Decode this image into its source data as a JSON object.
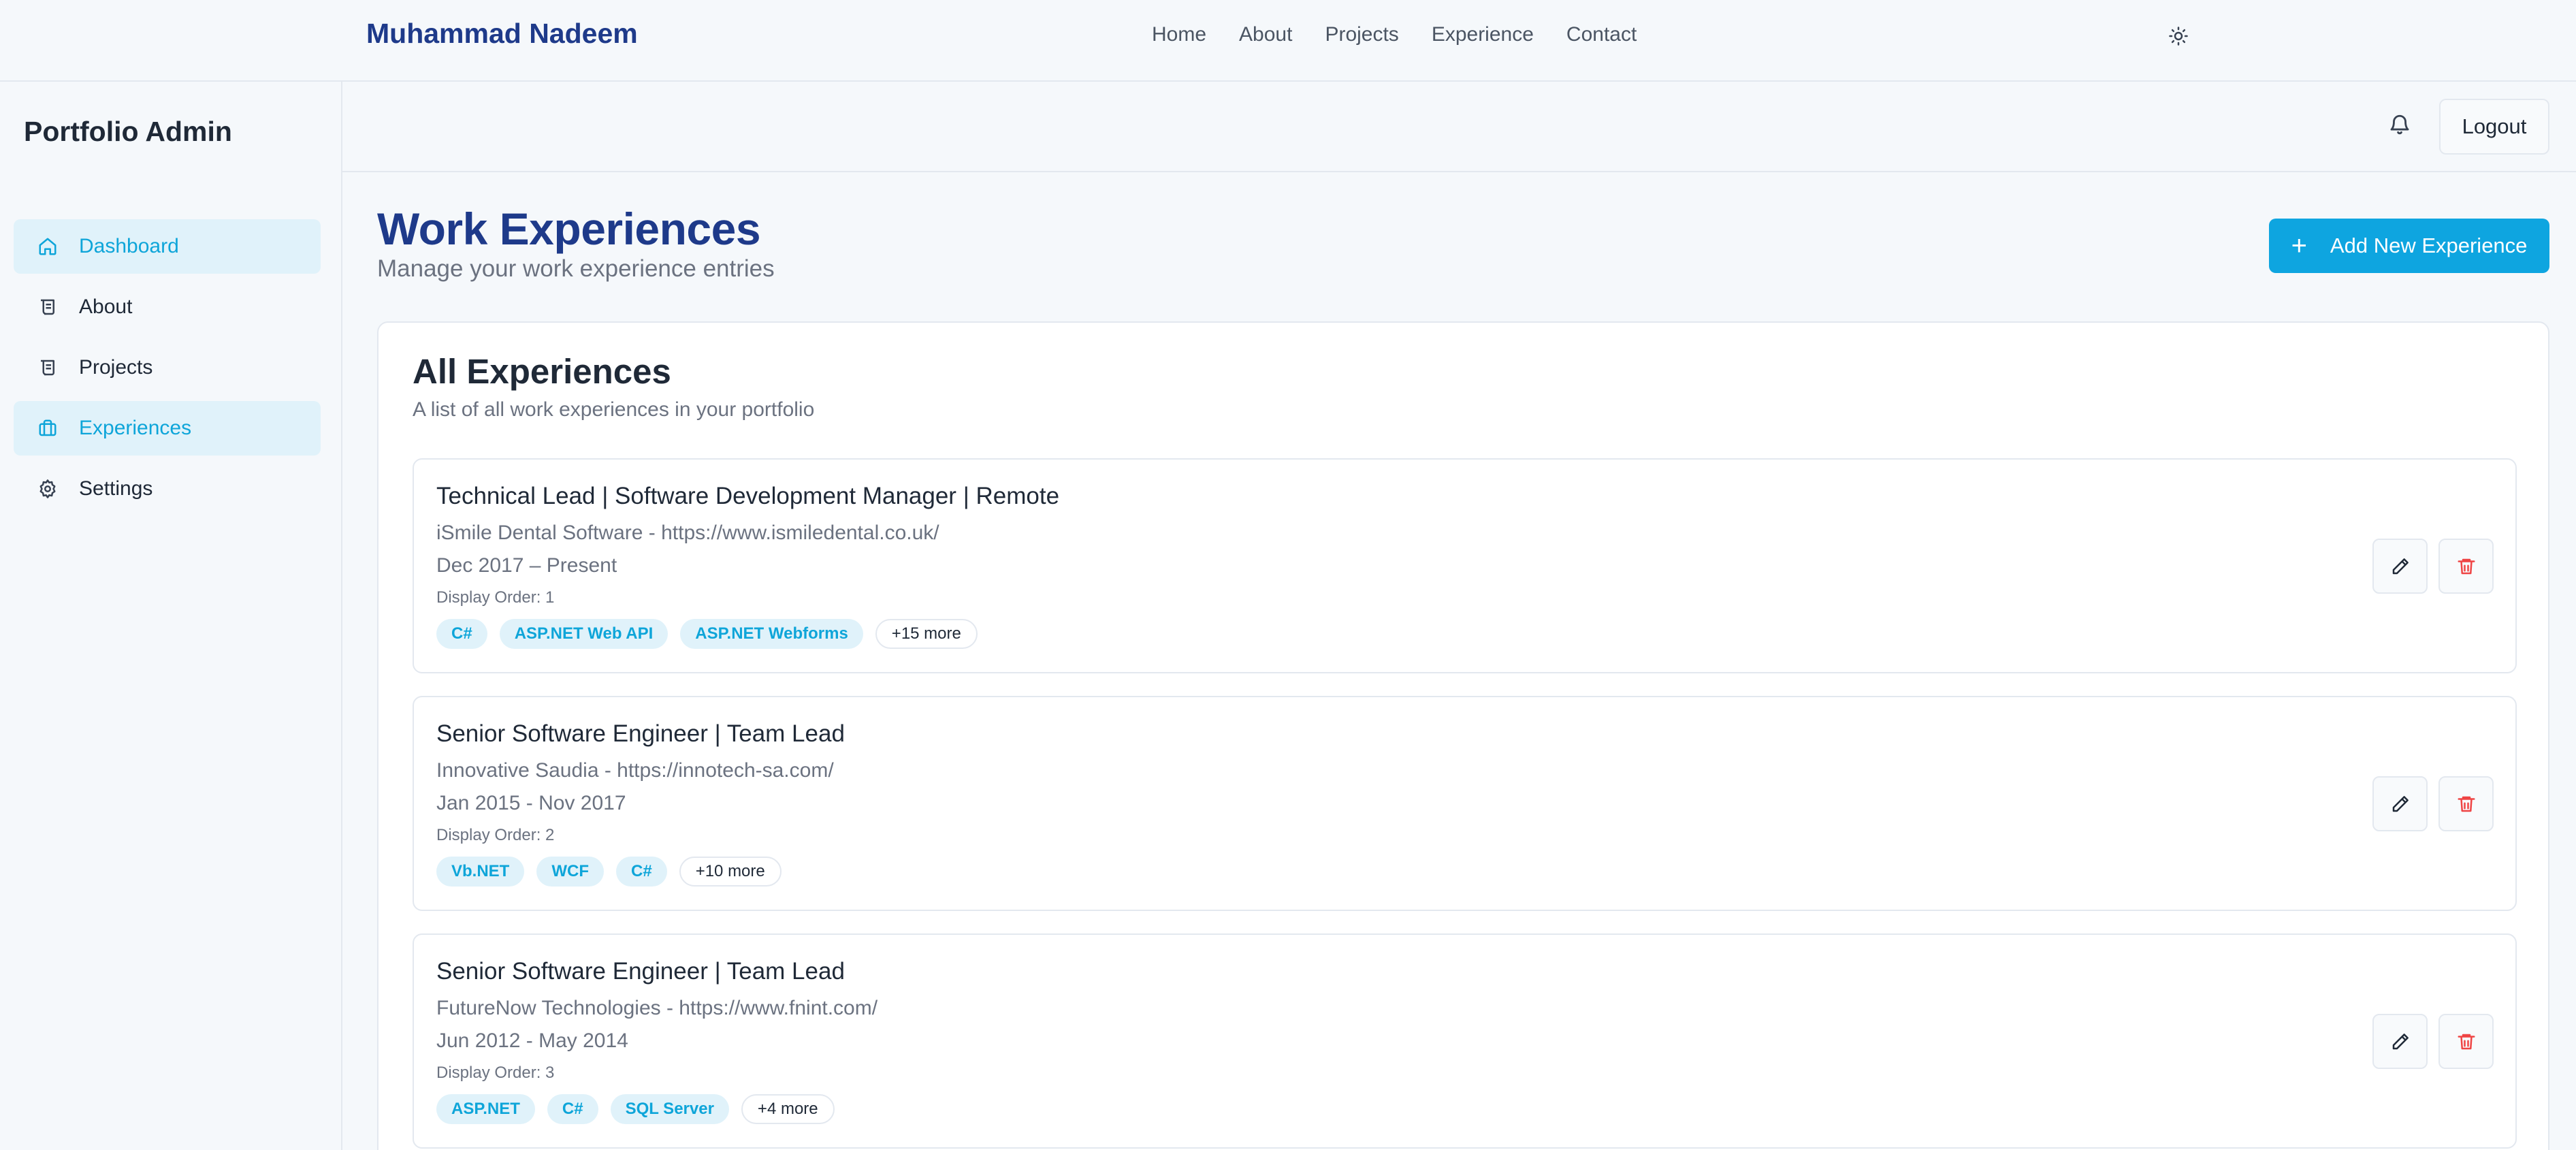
{
  "site": {
    "brand": "Muhammad Nadeem",
    "nav": [
      "Home",
      "About",
      "Projects",
      "Experience",
      "Contact"
    ]
  },
  "sidebar": {
    "title": "Portfolio Admin",
    "items": [
      {
        "label": "Dashboard",
        "icon": "home-icon",
        "active": true
      },
      {
        "label": "About",
        "icon": "scroll-icon",
        "active": false
      },
      {
        "label": "Projects",
        "icon": "scroll-icon",
        "active": false
      },
      {
        "label": "Experiences",
        "icon": "briefcase-icon",
        "active": true
      },
      {
        "label": "Settings",
        "icon": "gear-icon",
        "active": false
      }
    ]
  },
  "header": {
    "logout_label": "Logout"
  },
  "page": {
    "title": "Work Experiences",
    "subtitle": "Manage your work experience entries",
    "add_button_label": "Add New Experience"
  },
  "card": {
    "title": "All Experiences",
    "description": "A list of all work experiences in your portfolio"
  },
  "experiences": [
    {
      "title": "Technical Lead | Software Development Manager | Remote",
      "company": "iSmile Dental Software - https://www.ismiledental.co.uk/",
      "dates": "Dec 2017 – Present",
      "order": "Display Order: 1",
      "tags": [
        "C#",
        "ASP.NET Web API",
        "ASP.NET Webforms"
      ],
      "more": "+15 more"
    },
    {
      "title": "Senior Software Engineer | Team Lead",
      "company": "Innovative Saudia - https://innotech-sa.com/",
      "dates": "Jan 2015 - Nov 2017",
      "order": "Display Order: 2",
      "tags": [
        "Vb.NET",
        "WCF",
        "C#"
      ],
      "more": "+10 more"
    },
    {
      "title": "Senior Software Engineer | Team Lead",
      "company": "FutureNow Technologies - https://www.fnint.com/",
      "dates": "Jun 2012 - May 2014",
      "order": "Display Order: 3",
      "tags": [
        "ASP.NET",
        "C#",
        "SQL Server"
      ],
      "more": "+4 more"
    }
  ],
  "colors": {
    "accent": "#0ea5e0",
    "brand": "#1e3a8a",
    "danger": "#ef4444"
  }
}
